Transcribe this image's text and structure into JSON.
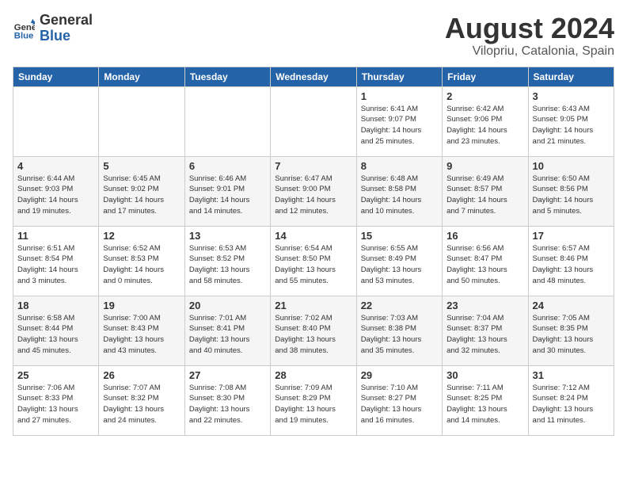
{
  "header": {
    "logo_general": "General",
    "logo_blue": "Blue",
    "month_year": "August 2024",
    "location": "Vilopriu, Catalonia, Spain"
  },
  "days_of_week": [
    "Sunday",
    "Monday",
    "Tuesday",
    "Wednesday",
    "Thursday",
    "Friday",
    "Saturday"
  ],
  "weeks": [
    [
      {
        "day": "",
        "info": ""
      },
      {
        "day": "",
        "info": ""
      },
      {
        "day": "",
        "info": ""
      },
      {
        "day": "",
        "info": ""
      },
      {
        "day": "1",
        "info": "Sunrise: 6:41 AM\nSunset: 9:07 PM\nDaylight: 14 hours\nand 25 minutes."
      },
      {
        "day": "2",
        "info": "Sunrise: 6:42 AM\nSunset: 9:06 PM\nDaylight: 14 hours\nand 23 minutes."
      },
      {
        "day": "3",
        "info": "Sunrise: 6:43 AM\nSunset: 9:05 PM\nDaylight: 14 hours\nand 21 minutes."
      }
    ],
    [
      {
        "day": "4",
        "info": "Sunrise: 6:44 AM\nSunset: 9:03 PM\nDaylight: 14 hours\nand 19 minutes."
      },
      {
        "day": "5",
        "info": "Sunrise: 6:45 AM\nSunset: 9:02 PM\nDaylight: 14 hours\nand 17 minutes."
      },
      {
        "day": "6",
        "info": "Sunrise: 6:46 AM\nSunset: 9:01 PM\nDaylight: 14 hours\nand 14 minutes."
      },
      {
        "day": "7",
        "info": "Sunrise: 6:47 AM\nSunset: 9:00 PM\nDaylight: 14 hours\nand 12 minutes."
      },
      {
        "day": "8",
        "info": "Sunrise: 6:48 AM\nSunset: 8:58 PM\nDaylight: 14 hours\nand 10 minutes."
      },
      {
        "day": "9",
        "info": "Sunrise: 6:49 AM\nSunset: 8:57 PM\nDaylight: 14 hours\nand 7 minutes."
      },
      {
        "day": "10",
        "info": "Sunrise: 6:50 AM\nSunset: 8:56 PM\nDaylight: 14 hours\nand 5 minutes."
      }
    ],
    [
      {
        "day": "11",
        "info": "Sunrise: 6:51 AM\nSunset: 8:54 PM\nDaylight: 14 hours\nand 3 minutes."
      },
      {
        "day": "12",
        "info": "Sunrise: 6:52 AM\nSunset: 8:53 PM\nDaylight: 14 hours\nand 0 minutes."
      },
      {
        "day": "13",
        "info": "Sunrise: 6:53 AM\nSunset: 8:52 PM\nDaylight: 13 hours\nand 58 minutes."
      },
      {
        "day": "14",
        "info": "Sunrise: 6:54 AM\nSunset: 8:50 PM\nDaylight: 13 hours\nand 55 minutes."
      },
      {
        "day": "15",
        "info": "Sunrise: 6:55 AM\nSunset: 8:49 PM\nDaylight: 13 hours\nand 53 minutes."
      },
      {
        "day": "16",
        "info": "Sunrise: 6:56 AM\nSunset: 8:47 PM\nDaylight: 13 hours\nand 50 minutes."
      },
      {
        "day": "17",
        "info": "Sunrise: 6:57 AM\nSunset: 8:46 PM\nDaylight: 13 hours\nand 48 minutes."
      }
    ],
    [
      {
        "day": "18",
        "info": "Sunrise: 6:58 AM\nSunset: 8:44 PM\nDaylight: 13 hours\nand 45 minutes."
      },
      {
        "day": "19",
        "info": "Sunrise: 7:00 AM\nSunset: 8:43 PM\nDaylight: 13 hours\nand 43 minutes."
      },
      {
        "day": "20",
        "info": "Sunrise: 7:01 AM\nSunset: 8:41 PM\nDaylight: 13 hours\nand 40 minutes."
      },
      {
        "day": "21",
        "info": "Sunrise: 7:02 AM\nSunset: 8:40 PM\nDaylight: 13 hours\nand 38 minutes."
      },
      {
        "day": "22",
        "info": "Sunrise: 7:03 AM\nSunset: 8:38 PM\nDaylight: 13 hours\nand 35 minutes."
      },
      {
        "day": "23",
        "info": "Sunrise: 7:04 AM\nSunset: 8:37 PM\nDaylight: 13 hours\nand 32 minutes."
      },
      {
        "day": "24",
        "info": "Sunrise: 7:05 AM\nSunset: 8:35 PM\nDaylight: 13 hours\nand 30 minutes."
      }
    ],
    [
      {
        "day": "25",
        "info": "Sunrise: 7:06 AM\nSunset: 8:33 PM\nDaylight: 13 hours\nand 27 minutes."
      },
      {
        "day": "26",
        "info": "Sunrise: 7:07 AM\nSunset: 8:32 PM\nDaylight: 13 hours\nand 24 minutes."
      },
      {
        "day": "27",
        "info": "Sunrise: 7:08 AM\nSunset: 8:30 PM\nDaylight: 13 hours\nand 22 minutes."
      },
      {
        "day": "28",
        "info": "Sunrise: 7:09 AM\nSunset: 8:29 PM\nDaylight: 13 hours\nand 19 minutes."
      },
      {
        "day": "29",
        "info": "Sunrise: 7:10 AM\nSunset: 8:27 PM\nDaylight: 13 hours\nand 16 minutes."
      },
      {
        "day": "30",
        "info": "Sunrise: 7:11 AM\nSunset: 8:25 PM\nDaylight: 13 hours\nand 14 minutes."
      },
      {
        "day": "31",
        "info": "Sunrise: 7:12 AM\nSunset: 8:24 PM\nDaylight: 13 hours\nand 11 minutes."
      }
    ]
  ]
}
